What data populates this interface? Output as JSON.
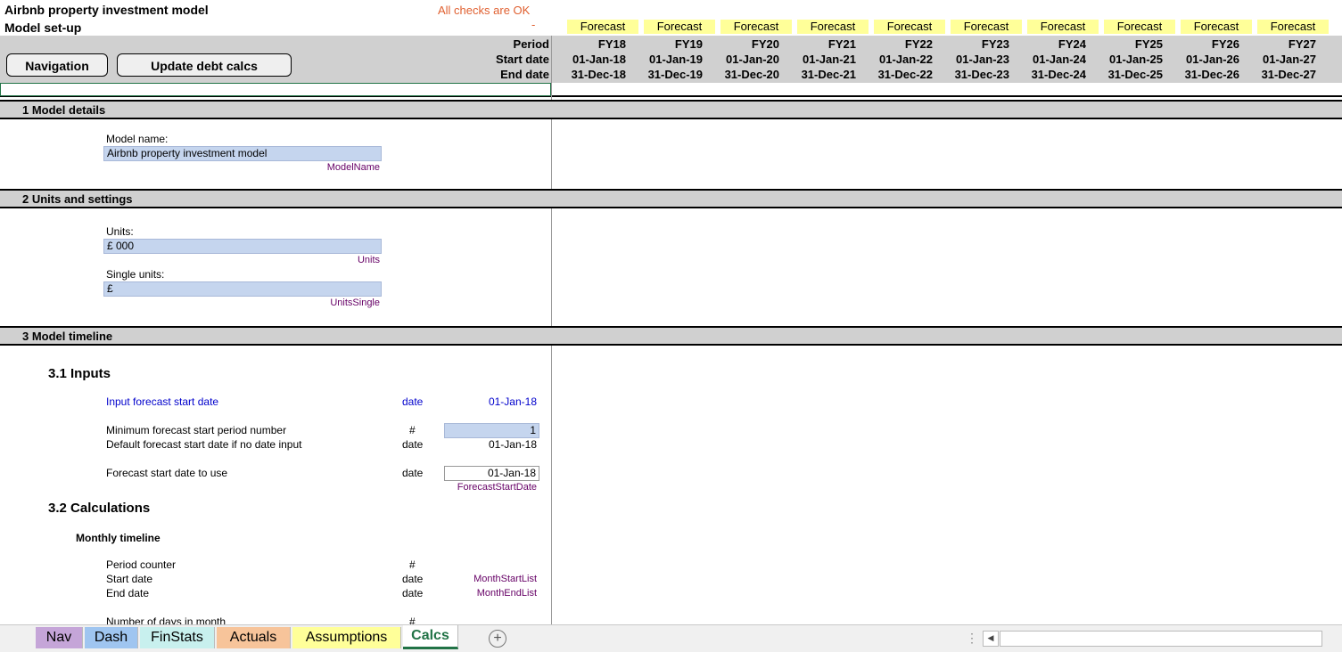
{
  "header": {
    "title": "Airbnb property investment model",
    "subtitle": "Model set-up",
    "checks": "All checks are OK",
    "checks_dash": "-",
    "period_label": "Period",
    "start_label": "Start date",
    "end_label": "End date"
  },
  "buttons": {
    "navigation": "Navigation",
    "update_debt": "Update debt calcs"
  },
  "periods": [
    {
      "flag": "Forecast",
      "fy": "FY18",
      "start": "01-Jan-18",
      "end": "31-Dec-18"
    },
    {
      "flag": "Forecast",
      "fy": "FY19",
      "start": "01-Jan-19",
      "end": "31-Dec-19"
    },
    {
      "flag": "Forecast",
      "fy": "FY20",
      "start": "01-Jan-20",
      "end": "31-Dec-20"
    },
    {
      "flag": "Forecast",
      "fy": "FY21",
      "start": "01-Jan-21",
      "end": "31-Dec-21"
    },
    {
      "flag": "Forecast",
      "fy": "FY22",
      "start": "01-Jan-22",
      "end": "31-Dec-22"
    },
    {
      "flag": "Forecast",
      "fy": "FY23",
      "start": "01-Jan-23",
      "end": "31-Dec-23"
    },
    {
      "flag": "Forecast",
      "fy": "FY24",
      "start": "01-Jan-24",
      "end": "31-Dec-24"
    },
    {
      "flag": "Forecast",
      "fy": "FY25",
      "start": "01-Jan-25",
      "end": "31-Dec-25"
    },
    {
      "flag": "Forecast",
      "fy": "FY26",
      "start": "01-Jan-26",
      "end": "31-Dec-26"
    },
    {
      "flag": "Forecast",
      "fy": "FY27",
      "start": "01-Jan-27",
      "end": "31-Dec-27"
    }
  ],
  "sections": {
    "s1": "1 Model details",
    "s2": "2 Units and settings",
    "s3": "3 Model timeline"
  },
  "model_details": {
    "label": "Model name:",
    "value": "Airbnb property investment model",
    "range": "ModelName"
  },
  "units": {
    "units_label": "Units:",
    "units_value": "£ 000",
    "units_range": "Units",
    "single_label": "Single units:",
    "single_value": "£",
    "single_range": "UnitsSingle"
  },
  "timeline": {
    "h_inputs": "3.1  Inputs",
    "input_start_label": "Input forecast start date",
    "input_start_unit": "date",
    "input_start_value": "01-Jan-18",
    "min_label": "Minimum forecast start period number",
    "min_unit": "#",
    "min_value": "1",
    "default_label": "Default forecast start date if no date input",
    "default_unit": "date",
    "default_value": "01-Jan-18",
    "use_label": "Forecast start date to use",
    "use_unit": "date",
    "use_value": "01-Jan-18",
    "use_range": "ForecastStartDate",
    "h_calcs": "3.2  Calculations",
    "h_monthly": "Monthly timeline",
    "counter_label": "Period counter",
    "counter_unit": "#",
    "mstart_label": "Start date",
    "mstart_unit": "date",
    "mstart_range": "MonthStartList",
    "mend_label": "End date",
    "mend_unit": "date",
    "mend_range": "MonthEndList",
    "days_label": "Number of days in month",
    "days_unit": "#"
  },
  "tabs": [
    {
      "label": "Nav",
      "color": "#c5a5d8"
    },
    {
      "label": "Dash",
      "color": "#9fc5f0"
    },
    {
      "label": "FinStats",
      "color": "#c8f0ee"
    },
    {
      "label": "Actuals",
      "color": "#f7c49a"
    },
    {
      "label": "Assumptions",
      "color": "#ffff99"
    },
    {
      "label": "Calcs",
      "color": "#ffffff"
    }
  ],
  "colors": {
    "check_ok": "#e06030",
    "input_fill": "#c5d5ee",
    "range_name": "#660066",
    "input_text": "#0000cc",
    "forecast_fill": "#ffff99"
  }
}
